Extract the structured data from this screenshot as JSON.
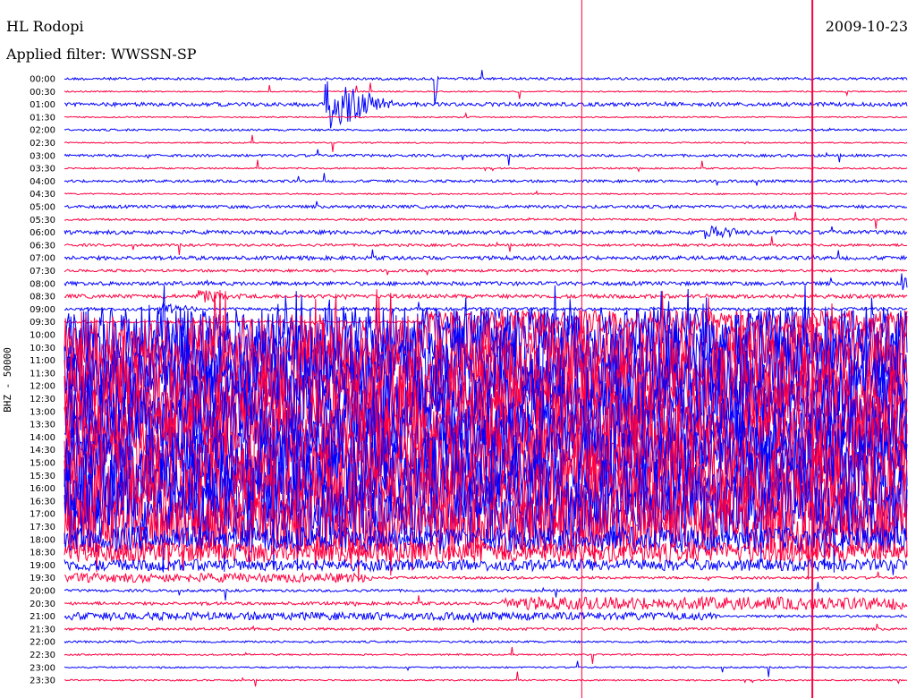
{
  "header": {
    "station": "HL Rodopi",
    "filter": "Applied filter: WWSSN-SP",
    "date": "2009-10-23"
  },
  "chart_data": {
    "type": "line",
    "title": "HL Rodopi",
    "subtitle": "Applied filter: WWSSN-SP",
    "ylabel": "BHZ - 50000",
    "x_minutes_per_line": 30,
    "colors": {
      "a": "#0000ff",
      "b": "#ff0040",
      "marker": "#ff0040"
    },
    "row_labels": [
      "00:00",
      "00:30",
      "01:00",
      "01:30",
      "02:00",
      "02:30",
      "03:00",
      "03:30",
      "04:00",
      "04:30",
      "05:00",
      "05:30",
      "06:00",
      "06:30",
      "07:00",
      "07:30",
      "08:00",
      "08:30",
      "09:00",
      "09:30",
      "10:00",
      "10:30",
      "11:00",
      "11:30",
      "12:00",
      "12:30",
      "13:00",
      "13:30",
      "14:00",
      "14:30",
      "15:00",
      "15:30",
      "16:00",
      "16:30",
      "17:00",
      "17:30",
      "18:00",
      "18:30",
      "19:00",
      "19:30",
      "20:00",
      "20:30",
      "21:00",
      "21:30",
      "22:00",
      "22:30",
      "23:00",
      "23:30"
    ],
    "noise_level": [
      0.1,
      0.05,
      0.15,
      0.05,
      0.08,
      0.05,
      0.1,
      0.06,
      0.1,
      0.06,
      0.12,
      0.08,
      0.15,
      0.1,
      0.15,
      0.1,
      0.15,
      0.15,
      0.12,
      0.1,
      2.2,
      2.6,
      2.8,
      2.8,
      2.8,
      2.8,
      2.8,
      2.8,
      2.8,
      2.8,
      2.8,
      2.8,
      2.8,
      2.8,
      2.6,
      2.4,
      1.0,
      0.8,
      0.45,
      0.35,
      0.1,
      0.12,
      0.3,
      0.1,
      0.08,
      0.06,
      0.06,
      0.06
    ],
    "segments": [
      {
        "row": 19,
        "from_min": 12.6,
        "to_min": 30,
        "level": 0.9
      },
      {
        "row": 39,
        "from_min": 11,
        "to_min": 30,
        "level": 0.1
      },
      {
        "row": 41,
        "from_min": 15.5,
        "to_min": 30,
        "level": 0.5
      },
      {
        "row": 42,
        "from_min": 23.2,
        "to_min": 30,
        "level": 0.1
      }
    ],
    "events": [
      {
        "row": 2,
        "minute": 9.3,
        "amplitude": 2.0,
        "duration_min": 2.5
      },
      {
        "row": 12,
        "minute": 22.8,
        "amplitude": 0.6,
        "duration_min": 2
      },
      {
        "row": 16,
        "minute": 29.8,
        "amplitude": 0.7,
        "duration_min": 0.5
      },
      {
        "row": 17,
        "minute": 4.8,
        "amplitude": 0.5,
        "duration_min": 1.5
      },
      {
        "row": 18,
        "minute": 3.4,
        "amplitude": 0.5,
        "duration_min": 1.5
      },
      {
        "row": 0,
        "minute": 13.2,
        "amplitude": 2.0,
        "duration_min": 0.05
      }
    ],
    "markers_min": [
      18.4,
      26.6
    ]
  }
}
